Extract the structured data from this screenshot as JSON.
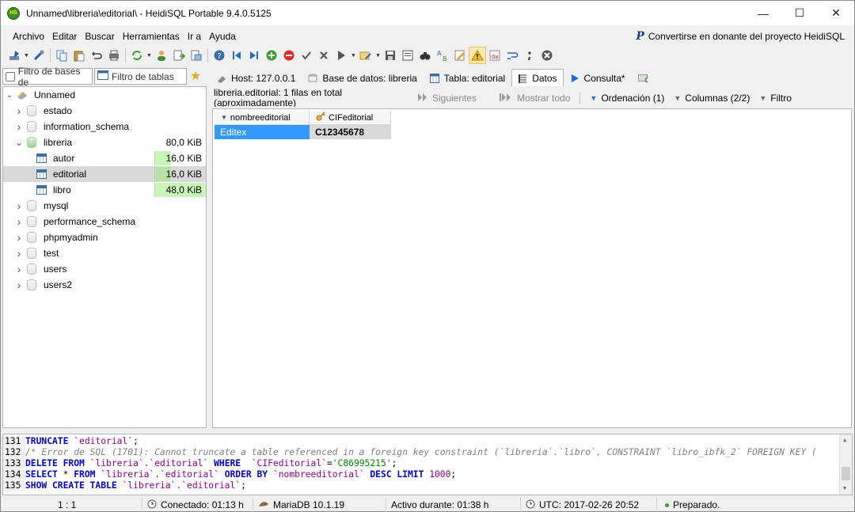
{
  "window": {
    "title": "Unnamed\\libreria\\editorial\\ - HeidiSQL Portable 9.4.0.5125",
    "app_icon_text": "HS",
    "minimize": "—",
    "maximize": "☐",
    "close": "✕"
  },
  "menu": {
    "items": [
      "Archivo",
      "Editar",
      "Buscar",
      "Herramientas",
      "Ir a",
      "Ayuda"
    ],
    "donate_label": "Convertirse en donante del proyecto HeidiSQL",
    "donate_icon": "P"
  },
  "toolbar": {
    "icons": [
      "connect-icon",
      "disconnect-icon",
      "copy-icon",
      "paste-icon",
      "undo-icon",
      "print-icon",
      "refresh-icon",
      "users-icon",
      "export-icon",
      "import-icon",
      "help-icon",
      "first-icon",
      "last-icon",
      "add-icon",
      "delete-icon",
      "apply-icon",
      "cancel-icon",
      "run-icon",
      "explain-icon",
      "save-icon",
      "load-icon",
      "binocular-icon",
      "replace-icon",
      "edit-icon",
      "warning-icon",
      "nullval-icon",
      "wrap-icon",
      "semicolon-icon",
      "stop-icon"
    ]
  },
  "filters": {
    "db_filter_placeholder": "Filtro de bases de",
    "table_filter_placeholder": "Filtro de tablas",
    "star_icon": "★"
  },
  "tree": {
    "root": "Unnamed",
    "items": [
      {
        "label": "estado",
        "level": 1,
        "type": "db",
        "expanded": false
      },
      {
        "label": "information_schema",
        "level": 1,
        "type": "db",
        "expanded": false
      },
      {
        "label": "libreria",
        "level": 1,
        "type": "db",
        "expanded": true,
        "size": "80,0 KiB"
      },
      {
        "label": "autor",
        "level": 2,
        "type": "table",
        "size": "16,0 KiB",
        "fill": 0.33
      },
      {
        "label": "editorial",
        "level": 2,
        "type": "table",
        "size": "16,0 KiB",
        "fill": 0.33,
        "selected": true
      },
      {
        "label": "libro",
        "level": 2,
        "type": "table",
        "size": "48,0 KiB",
        "fill": 1.0
      },
      {
        "label": "mysql",
        "level": 1,
        "type": "db",
        "expanded": false
      },
      {
        "label": "performance_schema",
        "level": 1,
        "type": "db",
        "expanded": false
      },
      {
        "label": "phpmyadmin",
        "level": 1,
        "type": "db",
        "expanded": false
      },
      {
        "label": "test",
        "level": 1,
        "type": "db",
        "expanded": false
      },
      {
        "label": "users",
        "level": 1,
        "type": "db",
        "expanded": false
      },
      {
        "label": "users2",
        "level": 1,
        "type": "db",
        "expanded": false
      }
    ]
  },
  "tabs": [
    {
      "label": "Host: 127.0.0.1",
      "icon": "host-icon",
      "active": false
    },
    {
      "label": "Base de datos: libreria",
      "icon": "database-icon",
      "active": false
    },
    {
      "label": "Tabla: editorial",
      "icon": "table-icon",
      "active": false
    },
    {
      "label": "Datos",
      "icon": "data-icon",
      "active": true
    },
    {
      "label": "Consulta*",
      "icon": "query-icon",
      "active": false
    }
  ],
  "data_view": {
    "info": "libreria.editorial: 1 filas en total (aproximadamente)",
    "next_label": "Siguientes",
    "show_all_label": "Mostrar todo",
    "sort_label": "Ordenación (1)",
    "columns_label": "Columnas (2/2)",
    "filter_label": "Filtro",
    "columns": [
      "nombreeditorial",
      "CIFeditorial"
    ],
    "rows": [
      [
        "Editex",
        "C12345678"
      ]
    ]
  },
  "sql_log": [
    {
      "n": "131",
      "parts": [
        [
          "kw",
          "TRUNCATE"
        ],
        [
          "txt",
          " "
        ],
        [
          "id",
          "`editorial`"
        ],
        [
          "txt",
          ";"
        ]
      ]
    },
    {
      "n": "132",
      "parts": [
        [
          "cmt",
          "/* Error de SQL (1701): Cannot truncate a table referenced in a foreign key constraint (`libreria`.`libro`, CONSTRAINT `libro_ibfk_2` FOREIGN KEY ("
        ]
      ]
    },
    {
      "n": "133",
      "parts": [
        [
          "kw",
          "DELETE FROM"
        ],
        [
          "txt",
          " "
        ],
        [
          "id",
          "`libreria`.`editorial`"
        ],
        [
          "txt",
          " "
        ],
        [
          "kw",
          "WHERE"
        ],
        [
          "txt",
          "  "
        ],
        [
          "id",
          "`CIFeditorial`"
        ],
        [
          "txt",
          "="
        ],
        [
          "str",
          "'C86995215'"
        ],
        [
          "txt",
          ";"
        ]
      ]
    },
    {
      "n": "134",
      "parts": [
        [
          "kw",
          "SELECT"
        ],
        [
          "txt",
          " * "
        ],
        [
          "kw",
          "FROM"
        ],
        [
          "txt",
          " "
        ],
        [
          "id",
          "`libreria`.`editorial`"
        ],
        [
          "txt",
          " "
        ],
        [
          "kw",
          "ORDER BY"
        ],
        [
          "txt",
          " "
        ],
        [
          "id",
          "`nombreeditorial`"
        ],
        [
          "txt",
          " "
        ],
        [
          "kw",
          "DESC LIMIT"
        ],
        [
          "txt",
          " "
        ],
        [
          "num",
          "1000"
        ],
        [
          "txt",
          ";"
        ]
      ]
    },
    {
      "n": "135",
      "parts": [
        [
          "kw",
          "SHOW CREATE TABLE"
        ],
        [
          "txt",
          " "
        ],
        [
          "id",
          "`libreria`.`editorial`"
        ],
        [
          "txt",
          ";"
        ]
      ]
    }
  ],
  "status": {
    "position": "1 : 1",
    "connected": "Conectado: 01:13 h",
    "server": "MariaDB 10.1.19",
    "active": "Activo durante: 01:38 h",
    "utc": "UTC: 2017-02-26 20:52",
    "state": "Preparado."
  },
  "colors": {
    "selection_blue": "#3399ff",
    "size_bar_green": "#c8f7b8",
    "keyword_blue": "#0000cd"
  }
}
